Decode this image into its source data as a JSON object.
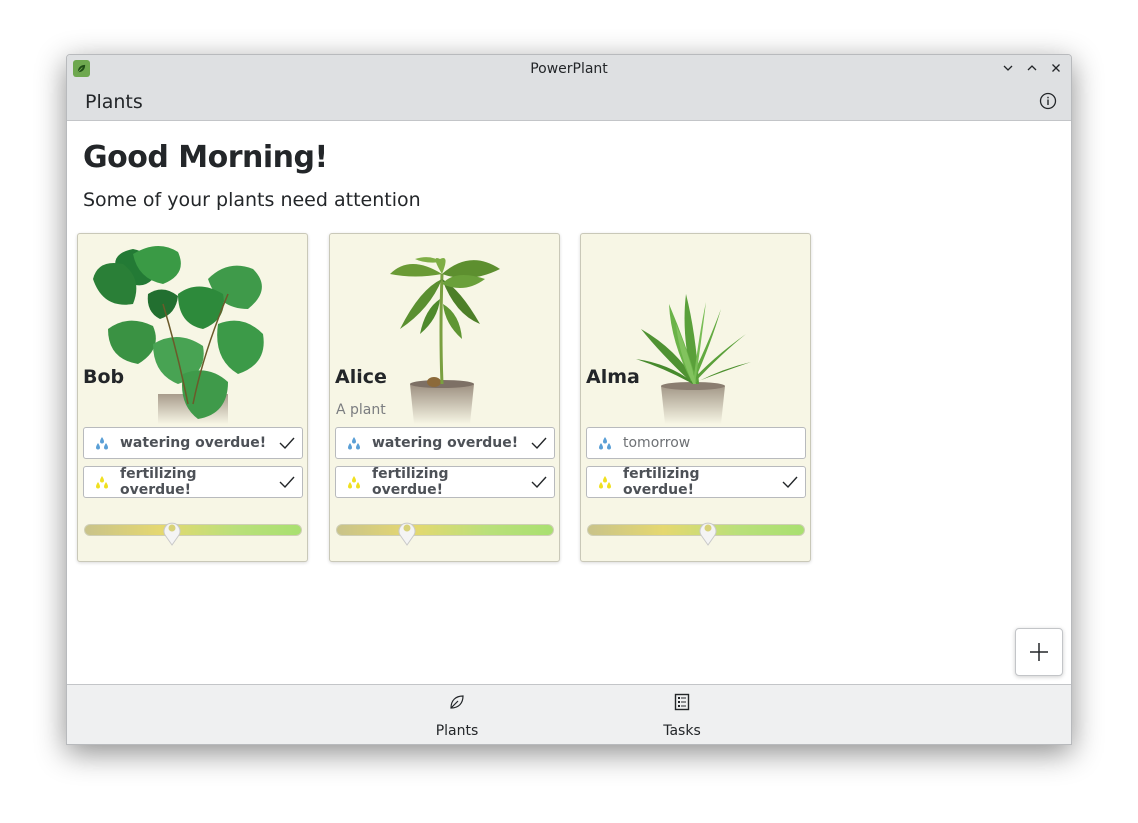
{
  "window": {
    "title": "PowerPlant"
  },
  "header": {
    "title": "Plants"
  },
  "main": {
    "greeting": "Good Morning!",
    "subtitle": "Some of your plants need attention"
  },
  "plants": [
    {
      "name": "Bob",
      "description": "",
      "image": "monstera-plant-image",
      "watering": {
        "label": "watering overdue!",
        "overdue": true
      },
      "fertilizing": {
        "label": "fertilizing overdue!",
        "overdue": true
      },
      "health": 0.4
    },
    {
      "name": "Alice",
      "description": "A plant",
      "image": "avocado-plant-image",
      "watering": {
        "label": "watering overdue!",
        "overdue": true
      },
      "fertilizing": {
        "label": "fertilizing overdue!",
        "overdue": true
      },
      "health": 0.32
    },
    {
      "name": "Alma",
      "description": "",
      "image": "aloe-plant-image",
      "watering": {
        "label": "tomorrow",
        "overdue": false
      },
      "fertilizing": {
        "label": "fertilizing overdue!",
        "overdue": true
      },
      "health": 0.55
    }
  ],
  "bottom_nav": {
    "items": [
      {
        "label": "Plants",
        "icon": "leaf-icon"
      },
      {
        "label": "Tasks",
        "icon": "checklist-icon"
      }
    ]
  },
  "colors": {
    "card_bg": "#f7f6e5",
    "water_icon": "#5a9fd6",
    "fertilizer_icon": "#f0e020",
    "health_low": "#c9c38a",
    "health_high": "#a9e070"
  }
}
